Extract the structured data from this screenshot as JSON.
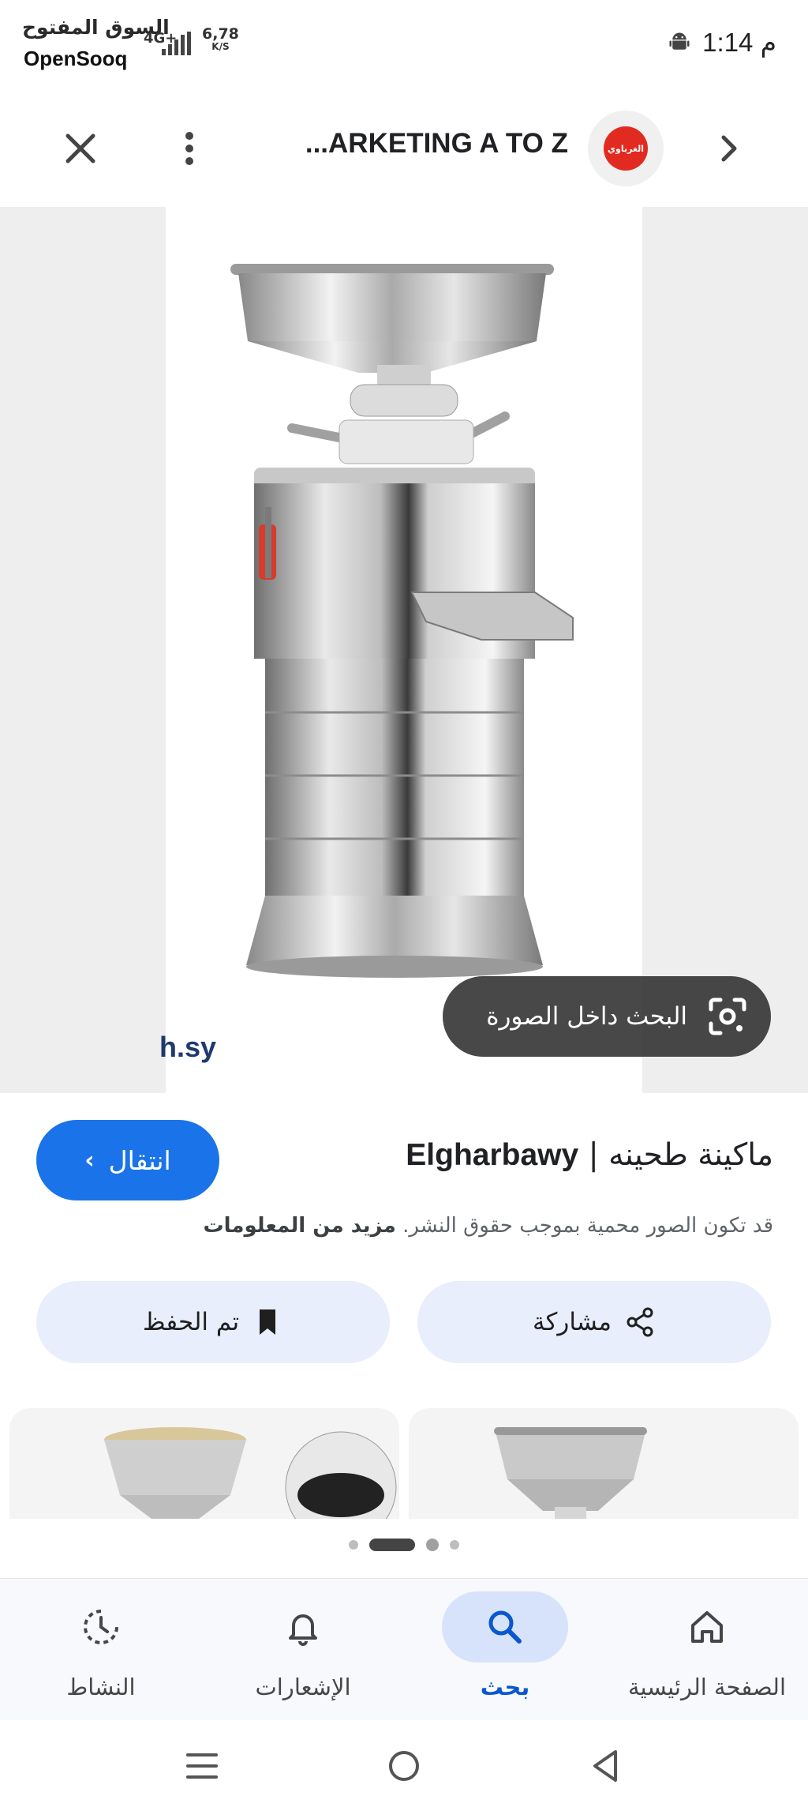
{
  "status_bar": {
    "watermark_arabic": "السوق المفتوح",
    "watermark_latin": "OpenSooq",
    "network": "4G+",
    "speed_value": "6,78",
    "speed_unit": "K/S",
    "time": "1:14 م",
    "icons": [
      "android-icon",
      "signal-icon"
    ]
  },
  "top_bar": {
    "title": "...ARKETING A TO Z",
    "logo_text": "الغرباوي",
    "icons": [
      "close-icon",
      "more-vert-icon",
      "chevron-right-icon"
    ]
  },
  "image": {
    "watermark": "h.sy",
    "lens_label": "البحث داخل الصورة",
    "lens_icon": "lens-camera-icon"
  },
  "info": {
    "visit_label": "انتقال",
    "title_arabic": "ماكينة طحينه",
    "title_separator": " | ",
    "title_brand": "Elgharbawy",
    "copyright_text": "قد تكون الصور محمية بموجب حقوق النشر.",
    "more_info": "مزيد من المعلومات"
  },
  "actions": {
    "save_label": "تم الحفظ",
    "share_label": "مشاركة",
    "icons": [
      "bookmark-icon",
      "share-icon"
    ]
  },
  "pager": {
    "pages": 4,
    "active": 1
  },
  "bottom_nav": {
    "items": [
      {
        "label": "الصفحة الرئيسية",
        "icon": "home-icon",
        "active": false
      },
      {
        "label": "بحث",
        "icon": "search-icon",
        "active": true
      },
      {
        "label": "الإشعارات",
        "icon": "bell-icon",
        "active": false
      },
      {
        "label": "النشاط",
        "icon": "activity-icon",
        "active": false
      }
    ]
  },
  "colors": {
    "accent": "#1a73e8",
    "chip_bg": "#e8eefb",
    "nav_active": "#0b57d0",
    "nav_pill": "#d7e3fb"
  }
}
